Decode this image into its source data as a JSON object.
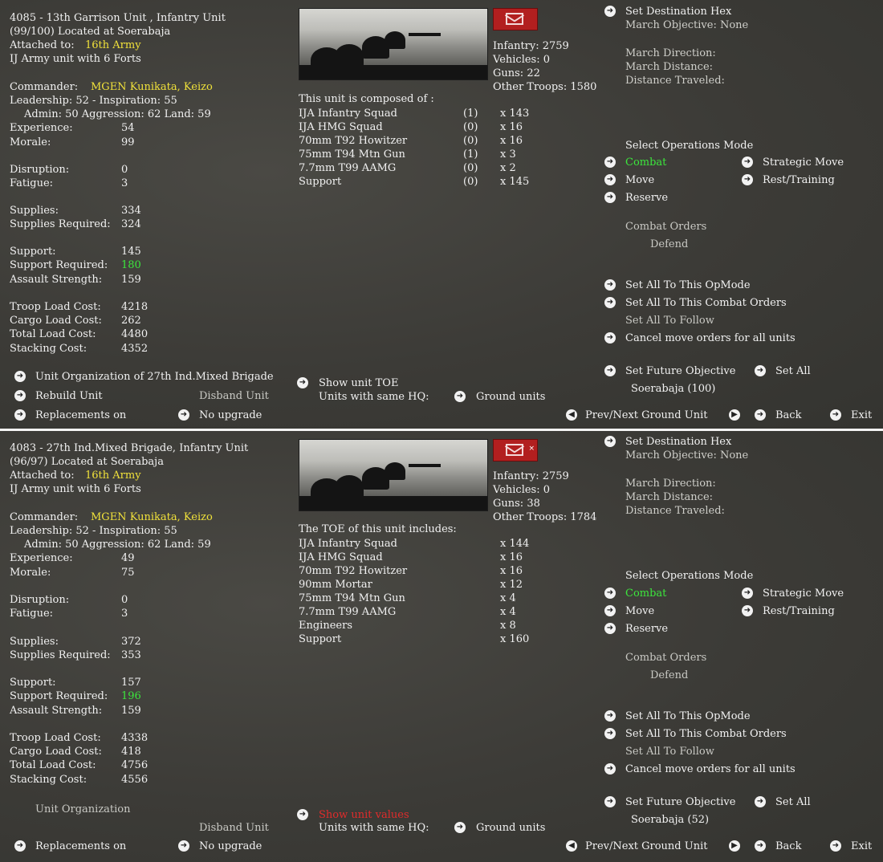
{
  "top": {
    "header": {
      "line1": "4085 - 13th Garrison Unit , Infantry Unit",
      "line2": "(99/100) Located at Soerabaja",
      "attached_label": "Attached to:",
      "attached_value": "16th Army",
      "line4": "IJ Army unit with 6 Forts"
    },
    "commander_label": "Commander:",
    "commander_value": "MGEN Kunikata, Keizo",
    "leadership": "Leadership: 52 - Inspiration: 55",
    "admin": "Admin: 50 Aggression: 62 Land: 59",
    "stats": [
      {
        "label": "Experience:",
        "value": "54"
      },
      {
        "label": "Morale:",
        "value": "99"
      },
      {
        "label": "Disruption:",
        "value": "0"
      },
      {
        "label": "Fatigue:",
        "value": "3"
      },
      {
        "label": "Supplies:",
        "value": "334"
      },
      {
        "label": "Supplies Required:",
        "value": "324"
      },
      {
        "label": "Support:",
        "value": "145"
      },
      {
        "label": "Support Required:",
        "value": "180"
      },
      {
        "label": "Assault Strength:",
        "value": "159"
      },
      {
        "label": "Troop Load Cost:",
        "value": "4218"
      },
      {
        "label": "Cargo Load Cost:",
        "value": "262"
      },
      {
        "label": "Total Load Cost:",
        "value": "4480"
      },
      {
        "label": "Stacking Cost:",
        "value": "4352"
      }
    ],
    "summary": {
      "infantry": "Infantry: 2759",
      "vehicles": "Vehicles: 0",
      "guns": "Guns: 22",
      "other": "Other Troops: 1580"
    },
    "composition_title": "This unit is composed of :",
    "composition": [
      {
        "name": "IJA Infantry Squad",
        "paren": "(1)",
        "count": "x 143"
      },
      {
        "name": "IJA HMG Squad",
        "paren": "(0)",
        "count": "x 16"
      },
      {
        "name": "70mm T92 Howitzer",
        "paren": "(0)",
        "count": "x 16"
      },
      {
        "name": "75mm T94 Mtn Gun",
        "paren": "(1)",
        "count": "x 3"
      },
      {
        "name": "7.7mm T99 AAMG",
        "paren": "(0)",
        "count": "x 2"
      },
      {
        "name": "Support",
        "paren": "(0)",
        "count": "x 145"
      }
    ],
    "right": {
      "set_dest": "Set Destination Hex",
      "march_obj": "March Objective: None",
      "march_dir": "March Direction:",
      "march_dist": "March Distance:",
      "dist_trav": "Distance Traveled:",
      "select_ops": "Select Operations Mode",
      "combat": "Combat",
      "strategic": "Strategic Move",
      "move": "Move",
      "rest": "Rest/Training",
      "reserve": "Reserve",
      "combat_orders": "Combat Orders",
      "defend": "Defend",
      "set_all_opmode": "Set All To This OpMode",
      "set_all_orders": "Set All To This Combat Orders",
      "set_all_follow": "Set All To Follow",
      "cancel_move": "Cancel move orders for all units",
      "future_obj": "Set Future Objective",
      "set_all": "Set All",
      "future_val": "Soerabaja (100)"
    },
    "bottom": {
      "unit_org": "Unit Organization of 27th Ind.Mixed Brigade",
      "rebuild": "Rebuild Unit",
      "disband": "Disband Unit",
      "replacements": "Replacements on",
      "no_upgrade": "No upgrade",
      "show_toe": "Show unit TOE",
      "same_hq": "Units with same HQ:",
      "ground_units": "Ground units",
      "prev_next": "Prev/Next Ground Unit",
      "back": "Back",
      "exit": "Exit"
    }
  },
  "bottom_panel": {
    "header": {
      "line1": "4083 - 27th Ind.Mixed Brigade, Infantry Unit",
      "line2": "(96/97) Located at Soerabaja",
      "attached_label": "Attached to:",
      "attached_value": "16th Army",
      "line4": "IJ Army unit with 6 Forts"
    },
    "commander_label": "Commander:",
    "commander_value": "MGEN Kunikata, Keizo",
    "leadership": "Leadership: 52 - Inspiration: 55",
    "admin": "Admin: 50 Aggression: 62 Land: 59",
    "stats": [
      {
        "label": "Experience:",
        "value": "49"
      },
      {
        "label": "Morale:",
        "value": "75"
      },
      {
        "label": "Disruption:",
        "value": "0"
      },
      {
        "label": "Fatigue:",
        "value": "3"
      },
      {
        "label": "Supplies:",
        "value": "372"
      },
      {
        "label": "Supplies Required:",
        "value": "353"
      },
      {
        "label": "Support:",
        "value": "157"
      },
      {
        "label": "Support Required:",
        "value": "196"
      },
      {
        "label": "Assault Strength:",
        "value": "159"
      },
      {
        "label": "Troop Load Cost:",
        "value": "4338"
      },
      {
        "label": "Cargo Load Cost:",
        "value": "418"
      },
      {
        "label": "Total Load Cost:",
        "value": "4756"
      },
      {
        "label": "Stacking Cost:",
        "value": "4556"
      }
    ],
    "summary": {
      "infantry": "Infantry: 2759",
      "vehicles": "Vehicles: 0",
      "guns": "Guns: 38",
      "other": "Other Troops: 1784"
    },
    "composition_title": "The TOE of this unit includes:",
    "composition": [
      {
        "name": "IJA Infantry Squad",
        "count": "x 144"
      },
      {
        "name": "IJA HMG Squad",
        "count": "x 16"
      },
      {
        "name": "70mm T92 Howitzer",
        "count": "x 16"
      },
      {
        "name": "90mm Mortar",
        "count": "x 12"
      },
      {
        "name": "75mm T94 Mtn Gun",
        "count": "x 4"
      },
      {
        "name": "7.7mm T99 AAMG",
        "count": "x 4"
      },
      {
        "name": "Engineers",
        "count": "x 8"
      },
      {
        "name": "Support",
        "count": "x 160"
      }
    ],
    "right": {
      "set_dest": "Set Destination Hex",
      "march_obj": "March Objective: None",
      "march_dir": "March Direction:",
      "march_dist": "March Distance:",
      "dist_trav": "Distance Traveled:",
      "select_ops": "Select Operations Mode",
      "combat": "Combat",
      "strategic": "Strategic Move",
      "move": "Move",
      "rest": "Rest/Training",
      "reserve": "Reserve",
      "combat_orders": "Combat Orders",
      "defend": "Defend",
      "set_all_opmode": "Set All To This OpMode",
      "set_all_orders": "Set All To This Combat Orders",
      "set_all_follow": "Set All To Follow",
      "cancel_move": "Cancel move orders for all units",
      "future_obj": "Set Future Objective",
      "set_all": "Set All",
      "future_val": "Soerabaja (52)"
    },
    "bottom": {
      "unit_org": "Unit Organization",
      "disband": "Disband Unit",
      "replacements": "Replacements on",
      "no_upgrade": "No upgrade",
      "show_values": "Show unit values",
      "same_hq": "Units with same HQ:",
      "ground_units": "Ground units",
      "prev_next": "Prev/Next Ground Unit",
      "back": "Back",
      "exit": "Exit"
    }
  },
  "icons": {
    "arrow": "right-arrow-icon",
    "arrow_left": "left-arrow-icon",
    "mail": "envelope-icon"
  },
  "colors": {
    "highlight": "#f0e13a",
    "active": "#3ce63c",
    "alert": "#e02b2b"
  }
}
